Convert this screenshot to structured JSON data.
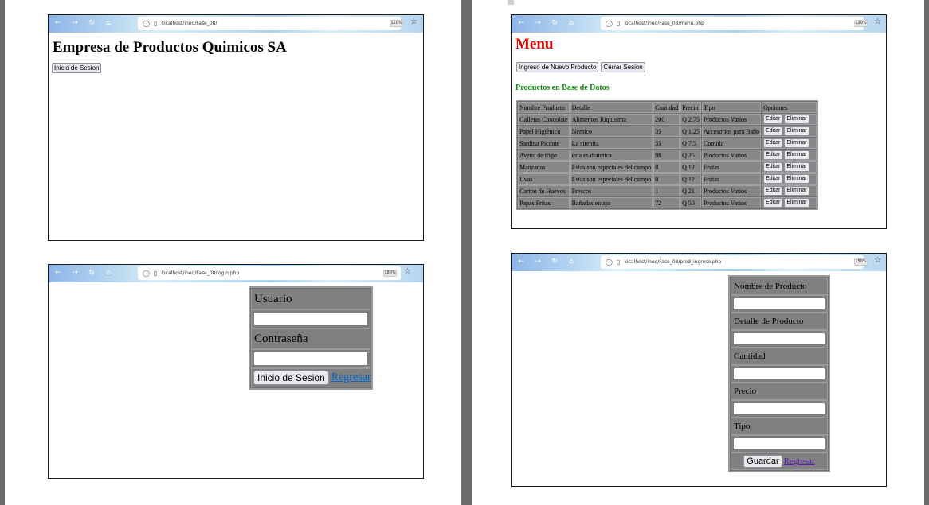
{
  "windows": {
    "home": {
      "url": "localhost/ined/Fase_08/",
      "zoom": "120%",
      "title": "Empresa de Productos Quimicos SA",
      "login_button": "Inicio de Sesion"
    },
    "login": {
      "url": "localhost/ined/Fase_08/login.php",
      "zoom": "180%",
      "user_label": "Usuario",
      "user_value": "",
      "password_label": "Contraseña",
      "password_value": "",
      "submit_button": "Inicio de Sesion",
      "back_link": "Regresar"
    },
    "menu": {
      "url": "localhost/ined/Fase_08/menu.php",
      "zoom": "120%",
      "title": "Menu",
      "new_product_button": "Ingreso de Nuevo Producto",
      "logout_button": "Cerrar Sesion",
      "subtitle": "Productos en Base de Datos",
      "columns": [
        "Nombre Producto",
        "Detalle",
        "Cantidad",
        "Precio",
        "Tipo",
        "Opciones"
      ],
      "edit_label": "Editar",
      "delete_label": "Eliminar",
      "rows": [
        [
          "Galletas Chocolate",
          "Alimentos Riquisima",
          "200",
          "Q 2.75",
          "Productos Varios"
        ],
        [
          "Papel Higiènico",
          "Nemico",
          "35",
          "Q 1.25",
          "Accesorios para Baño"
        ],
        [
          "Sardina Picante",
          "La sirenita",
          "55",
          "Q 7.5",
          "Comida"
        ],
        [
          "Avena de trigo",
          "esta es diatetica",
          "98",
          "Q 25",
          "Productos Varios"
        ],
        [
          "Manzanas",
          "Estas son especiales del campo",
          "0",
          "Q 12",
          "Frutas"
        ],
        [
          "Uvas",
          "Estas son especiales del campo",
          "0",
          "Q 12",
          "Frutas"
        ],
        [
          "Carton de Huevos",
          "Frescos",
          "1",
          "Q 21",
          "Productos Varios"
        ],
        [
          "Papas Fritas",
          "Bañadas en ajo",
          "72",
          "Q 50",
          "Productos Varios"
        ]
      ]
    },
    "product_form": {
      "url": "localhost/ined/Fase_08/prod_ingreso.php",
      "zoom": "150%",
      "name_label": "Nombre de Producto",
      "detail_label": "Detalle de Producto",
      "quantity_label": "Cantidad",
      "price_label": "Precio",
      "type_label": "Tipo",
      "save_button": "Guardar",
      "back_link": "Regresar"
    }
  },
  "icons": {
    "back": "arrow-left-icon",
    "forward": "arrow-right-icon",
    "reload": "reload-icon",
    "home": "home-icon",
    "shield": "shield-icon",
    "page": "page-icon",
    "bookmark": "star-icon"
  },
  "colors": {
    "menu_title": "#e00000",
    "subtitle": "#138a13",
    "link": "#0066cc",
    "visited_link": "#5a1bb8",
    "table_cell": "#878787"
  }
}
